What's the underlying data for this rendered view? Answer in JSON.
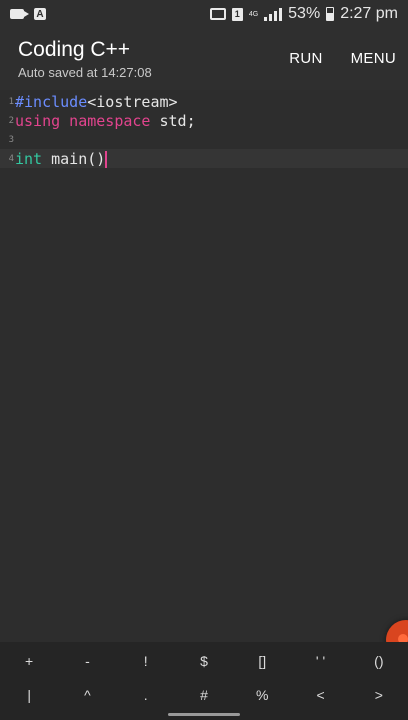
{
  "status_bar": {
    "sim_label": "1",
    "network": "4G",
    "battery_percent": "53%",
    "time": "2:27 pm"
  },
  "app_bar": {
    "title": "Coding C++",
    "subtitle": "Auto saved at 14:27:08",
    "run_label": "RUN",
    "menu_label": "MENU"
  },
  "editor": {
    "lines": [
      {
        "number": "1",
        "tokens": [
          "#include",
          "<iostream>"
        ]
      },
      {
        "number": "2",
        "tokens": [
          "using namespace",
          " std;"
        ]
      },
      {
        "number": "3",
        "tokens": []
      },
      {
        "number": "4",
        "tokens": [
          "int",
          " main()"
        ]
      }
    ]
  },
  "symbols": {
    "row1": [
      "+",
      "-",
      "!",
      "$",
      "[]",
      "' '",
      "()"
    ],
    "row2": [
      "|",
      "^",
      ".",
      "#",
      "%",
      "<",
      ">"
    ]
  },
  "colors": {
    "background": "#2b2b2b",
    "preprocessor": "#6b8dff",
    "keyword": "#e2448e",
    "type": "#33c7a0",
    "cursor": "#e2448e",
    "fab": "#d9451f"
  }
}
